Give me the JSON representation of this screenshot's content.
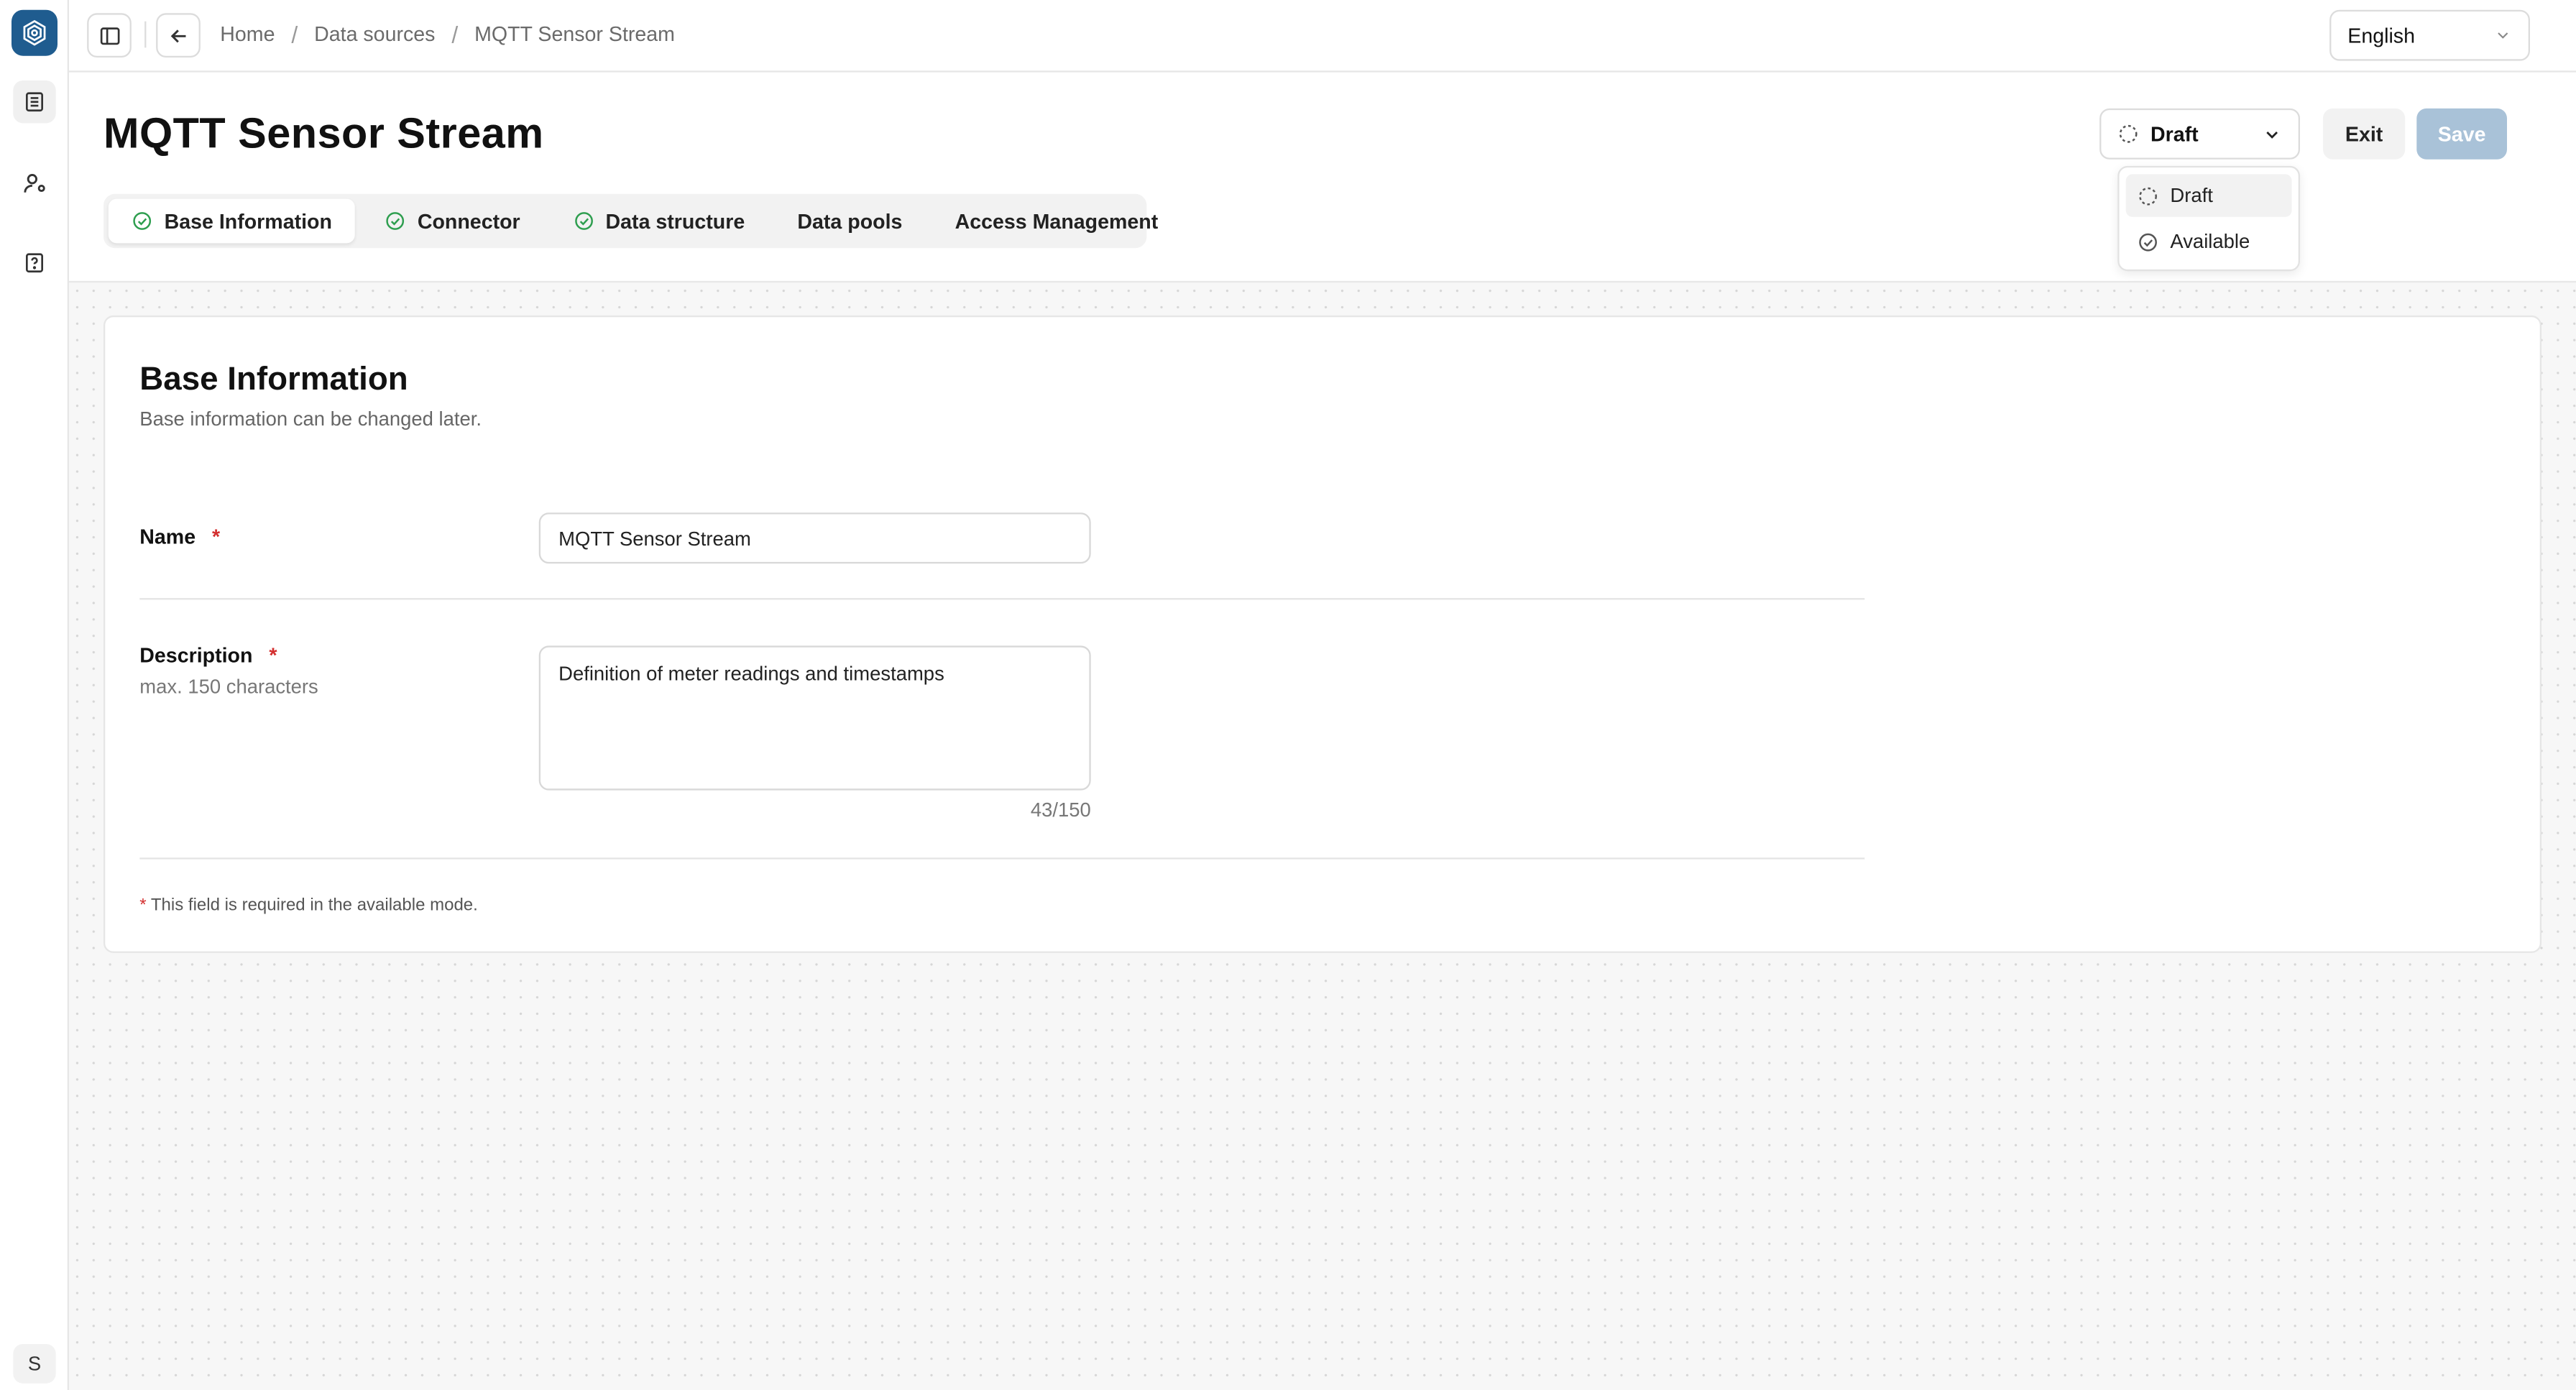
{
  "app": {
    "logo_icon": "hexagon-gear-icon",
    "brand_color": "#1f5c8f"
  },
  "rail": {
    "items": [
      {
        "icon": "document-list-icon",
        "active": true
      },
      {
        "icon": "user-settings-icon",
        "active": false
      },
      {
        "icon": "help-document-icon",
        "active": false
      }
    ],
    "avatar_initial": "S"
  },
  "topbar": {
    "sidebar_toggle_icon": "sidebar-panel-icon",
    "back_icon": "arrow-left-icon",
    "breadcrumb": [
      "Home",
      "Data sources",
      "MQTT Sensor Stream"
    ],
    "breadcrumb_separator": "/",
    "language": {
      "selected": "English"
    }
  },
  "header": {
    "title": "MQTT Sensor Stream",
    "status_select": {
      "selected": "Draft"
    },
    "exit_label": "Exit",
    "save_label": "Save",
    "save_color": "#a9c2d8"
  },
  "status_dropdown": {
    "options": [
      {
        "label": "Draft",
        "icon": "dashed-circle-icon"
      },
      {
        "label": "Available",
        "icon": "check-circle-icon"
      }
    ]
  },
  "tabs": [
    {
      "label": "Base Information",
      "completed": true,
      "active": true
    },
    {
      "label": "Connector",
      "completed": true,
      "active": false
    },
    {
      "label": "Data structure",
      "completed": true,
      "active": false
    },
    {
      "label": "Data pools",
      "completed": false,
      "active": false
    },
    {
      "label": "Access Management",
      "completed": false,
      "active": false
    }
  ],
  "form": {
    "title": "Base Information",
    "subtitle": "Base information can be changed later.",
    "name": {
      "label": "Name",
      "required_mark": "*",
      "value": "MQTT Sensor Stream"
    },
    "description": {
      "label": "Description",
      "required_mark": "*",
      "hint": "max. 150 characters",
      "value": "Definition of meter readings and timestamps",
      "counter": "43/150"
    },
    "footnote_mark": "*",
    "footnote": "This field is required in the available mode.",
    "required_color": "#d32f2f",
    "check_color": "#2e9e4f"
  }
}
